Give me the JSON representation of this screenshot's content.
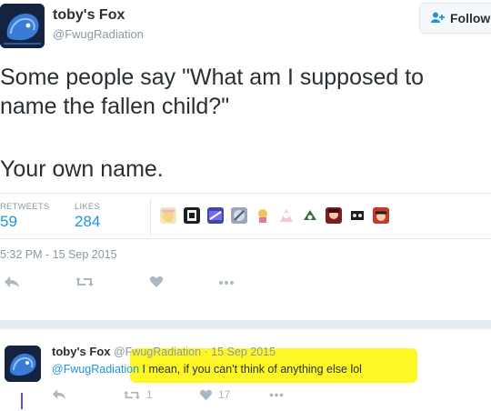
{
  "tweet": {
    "author_name": "toby's Fox",
    "author_handle": "@FwugRadiation",
    "follow_label": "Follow",
    "text_line1": "Some people say \"What am I supposed to",
    "text_line2": "name the fallen child?\"",
    "text_line3": "Your own name.",
    "retweets_label": "RETWEETS",
    "retweets_count": "59",
    "likes_label": "LIKES",
    "likes_count": "284",
    "timestamp": "5:32 PM - 15 Sep 2015"
  },
  "reply": {
    "author_name": "toby's Fox",
    "author_handle": "@FwugRadiation",
    "date_sep": " · ",
    "date": "15 Sep 2015",
    "mention": "@FwugRadiation",
    "text": " I mean, if you can't think of anything else lol",
    "retweet_count": "1",
    "like_count": "17"
  },
  "colors": {
    "accent": "#1b95e0",
    "muted": "#8899a6",
    "highlight": "#fff500",
    "avatar_bg": "#14233f"
  },
  "icons": [
    "follow-user-icon",
    "reply-icon",
    "retweet-icon",
    "like-icon",
    "more-icon"
  ]
}
